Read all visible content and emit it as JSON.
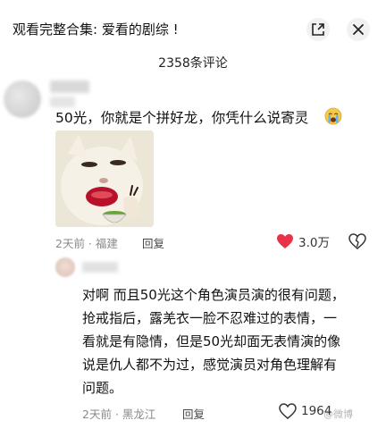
{
  "header": {
    "title": "观看完整合集: 爱看的剧综 !",
    "pip_icon": "picture-in-picture-icon",
    "close_icon": "close-icon"
  },
  "comment_count": "2358条评论",
  "comments": [
    {
      "text": "50光，你就是个拼好龙，你凭什么说寄灵",
      "emoji": "loudly-crying-face",
      "image_subject": "cat-with-lipstick-holding-tea",
      "meta": "2天前 · 福建",
      "reply_label": "回复",
      "likes": "3.0万",
      "liked": true,
      "like_color": "#e8324a"
    },
    {
      "lines": [
        "对啊 而且50光这个角色演员演的很有问题，",
        "抢戒指后，露羌衣一脸不忍难过的表情，一",
        "看就是有隐情，但是50光却面无表情演的像",
        "说是仇人都不为过，感觉演员对角色理解有",
        "问题。"
      ],
      "meta": "2天前 · 黑龙江",
      "reply_label": "回复",
      "likes": "1964",
      "liked": false
    }
  ],
  "watermark": "@微博"
}
